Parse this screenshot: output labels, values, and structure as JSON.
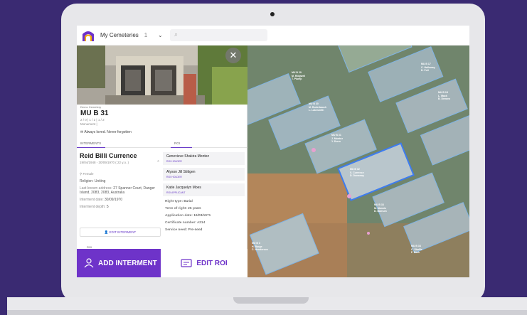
{
  "header": {
    "cemetery_name": "My Cemeteries",
    "cemetery_count": "1",
    "search_placeholder": ""
  },
  "plot": {
    "cemetery": "Demo Cemetery",
    "id": "MU B 31",
    "stats": "2 / 0 | 1 / 2 | 1 / 2",
    "type": "Monument |",
    "epitaph": "Always loved. Never forgotten"
  },
  "tabs": [
    "INTERMENTS",
    "ROI"
  ],
  "interment": {
    "name": "Reid Billi Currence",
    "dates": "19/04/1948 - 30/09/1970 ( 22 y.o. )",
    "gender": "Female",
    "religion": "Religion: Uniting",
    "address_label": "Last known address:",
    "address": "27 Spanner Court, Danger Island, 2083, 2083, Australia",
    "date_label": "Interment date:",
    "date": "30/09/1970",
    "depth_label": "Interment depth:",
    "depth": "5",
    "edit_label": "EDIT INTERMENT",
    "roi_label": "ROI"
  },
  "roi": {
    "holders": [
      {
        "name": "Genevieve Shakira Montez",
        "role": "ROI HOLDER"
      },
      {
        "name": "Alyson Jill Stittgen",
        "role": "ROI HOLDER"
      },
      {
        "name": "Katie Jacquelyn Moes",
        "role": "ROI APPLICANT"
      }
    ],
    "right_type_label": "Right type:",
    "right_type": "Burial",
    "term_label": "Term of right:",
    "term": "25 years",
    "app_date_label": "Application date:",
    "app_date": "16/03/1971",
    "cert_label": "Certificate number:",
    "cert": "A314",
    "service_label": "Service need:",
    "service": "Pre-need"
  },
  "actions": {
    "add_interment": "ADD INTERMENT",
    "edit_roi": "EDIT ROI"
  },
  "map_labels": [
    {
      "title": "MU B 29",
      "l1": "M. Ridgwell",
      "l2": "T. Plump"
    },
    {
      "title": "MU B 30",
      "l1": "M. Ruderbauch",
      "l2": "L. Lakesmith"
    },
    {
      "title": "MU B 31",
      "l1": "J. Montez",
      "l2": "Y. Dunn"
    },
    {
      "title": "MU B 32",
      "l1": "S. Currence",
      "l2": "D. Dunaway"
    },
    {
      "title": "MU B 33",
      "l1": "M. Mannis",
      "l2": "D. Barnum"
    },
    {
      "title": "MU B 17",
      "l1": "C. Halloway",
      "l2": "D. Foll"
    },
    {
      "title": "MU B 18",
      "l1": "L. Mack",
      "l2": "B. Denavo"
    },
    {
      "title": "MU B 3",
      "l1": "H. Burge",
      "l2": "C. Henderson"
    },
    {
      "title": "MU B 34",
      "l1": "C. Shallis",
      "l2": "F. Dash"
    }
  ],
  "colors": {
    "accent": "#6e33c9"
  }
}
